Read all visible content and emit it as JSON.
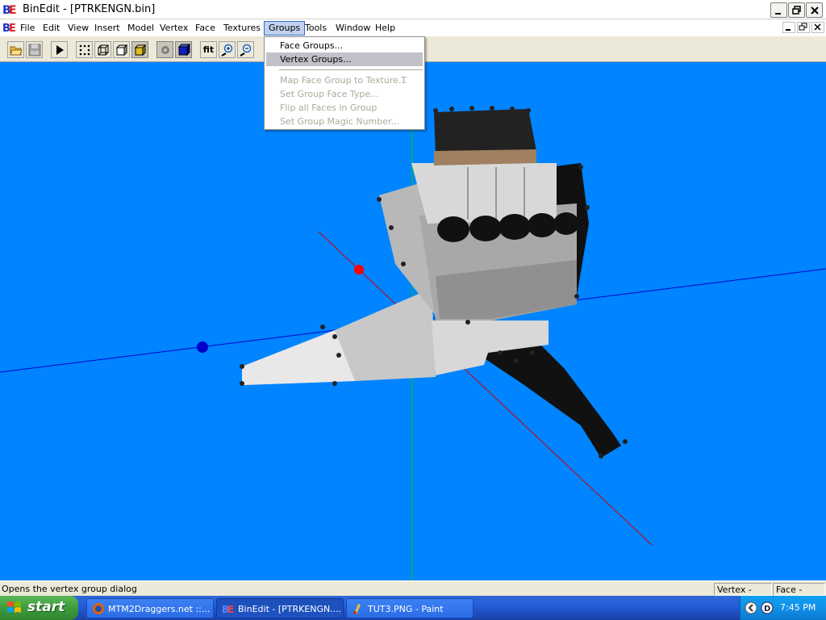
{
  "window": {
    "title": "BinEdit - [PTRKENGN.bin]"
  },
  "menubar": {
    "items": [
      "File",
      "Edit",
      "View",
      "Insert",
      "Model",
      "Vertex",
      "Face",
      "Textures",
      "Groups",
      "Tools",
      "Window",
      "Help"
    ],
    "active": "Groups"
  },
  "toolbar": {
    "fit_label": "fit"
  },
  "groups_menu": {
    "face_groups": "Face Groups...",
    "vertex_groups": "Vertex Groups...",
    "map_face_group": "Map Face Group to Texture...",
    "map_face_group_shortcut": "T",
    "set_group_face_type": "Set Group Face Type...",
    "flip_all_faces": "Flip all Faces in Group",
    "set_group_magic": "Set Group Magic Number..."
  },
  "statusbar": {
    "message": "Opens the vertex group dialog",
    "vertex_status": "Vertex - None",
    "face_status": "Face - None"
  },
  "taskbar": {
    "start_label": "start",
    "tasks": [
      {
        "label": "MTM2Draggers.net ::..."
      },
      {
        "label": "BinEdit - [PTRKENGN...."
      },
      {
        "label": "TUT3.PNG - Paint"
      }
    ],
    "clock": "7:45 PM"
  },
  "colors": {
    "viewport_bg": "#0084ff",
    "menu_highlight": "#c1c1c9",
    "axis_x": "#ff0000",
    "axis_y": "#00cc00",
    "axis_z": "#0000cc"
  }
}
